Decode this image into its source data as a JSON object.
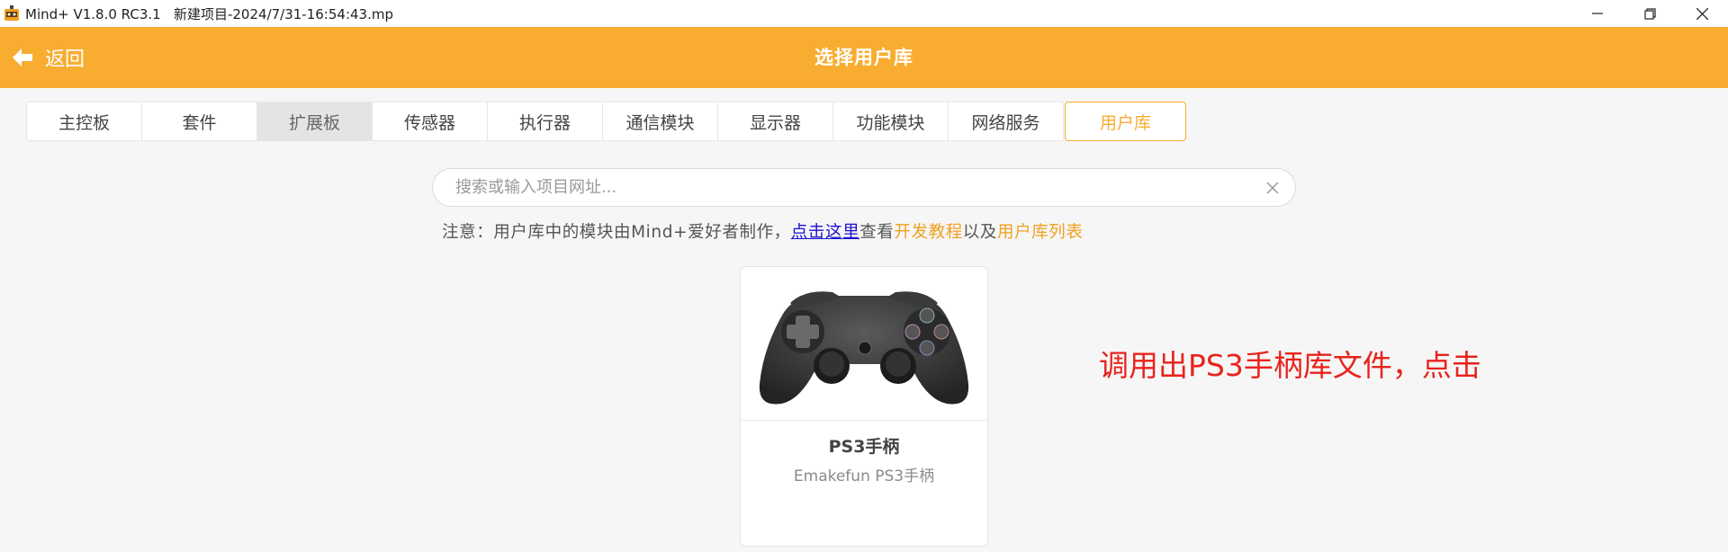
{
  "window": {
    "title": "Mind+ V1.8.0 RC3.1   新建项目-2024/7/31-16:54:43.mp",
    "icons": [
      "app-logo-icon",
      "minimize-icon",
      "restore-icon",
      "close-icon"
    ]
  },
  "header": {
    "back_label": "返回",
    "title": "选择用户库",
    "accent_color": "#f8ad30"
  },
  "tabs": [
    {
      "label": "主控板"
    },
    {
      "label": "套件"
    },
    {
      "label": "扩展板"
    },
    {
      "label": "传感器"
    },
    {
      "label": "执行器"
    },
    {
      "label": "通信模块"
    },
    {
      "label": "显示器"
    },
    {
      "label": "功能模块"
    },
    {
      "label": "网络服务"
    },
    {
      "label": "用户库"
    }
  ],
  "active_tab": "用户库",
  "search": {
    "placeholder": "搜索或输入项目网址...",
    "value": ""
  },
  "notice": {
    "prefix": "注意：用户库中的模块由Mind+爱好者制作，",
    "link_here": "点击这里",
    "mid1": "查看",
    "link_tutorial": "开发教程",
    "mid2": "以及",
    "link_list": "用户库列表"
  },
  "cards": [
    {
      "name": "PS3手柄",
      "description": "Emakefun PS3手柄",
      "image": "gamepad-image"
    }
  ],
  "annotation": "调用出PS3手柄库文件，点击"
}
